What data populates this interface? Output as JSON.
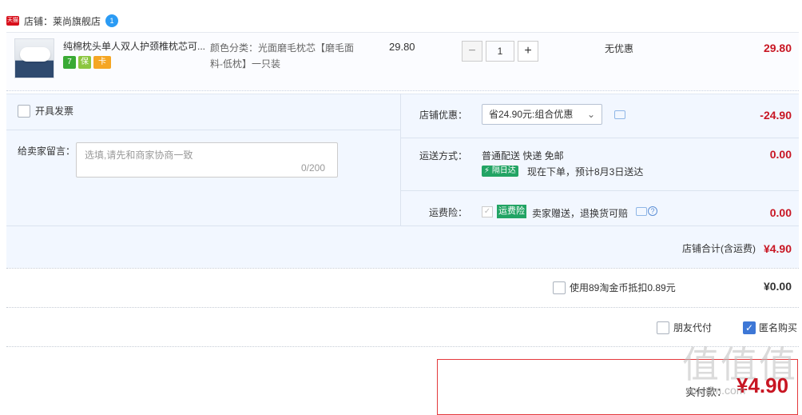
{
  "shop": {
    "badge": "天猫",
    "label": "店铺：",
    "name": "莱尚旗舰店",
    "wangwang_label": "1"
  },
  "item": {
    "title": "纯棉枕头单人双人护颈椎枕芯可...",
    "sku": "颜色分类：光面磨毛枕芯【磨毛面料-低枕】一只装",
    "unit_price": "29.80",
    "quantity": "1",
    "minus": "−",
    "plus": "+",
    "discount": "无优惠",
    "total": "29.80",
    "badges": [
      {
        "icon": "seven-day-return-icon",
        "text": "7",
        "color": "#3aaa35"
      },
      {
        "icon": "guarantee-icon",
        "text": "保",
        "color": "#8cc63f"
      },
      {
        "icon": "credit-card-icon",
        "text": "卡",
        "color": "#f5a623"
      }
    ]
  },
  "invoice": {
    "label": "开具发票"
  },
  "message": {
    "label": "给卖家留言：",
    "placeholder": "选填,请先和商家协商一致",
    "count": "0/200"
  },
  "promo": {
    "label": "店铺优惠：",
    "selected": "省24.90元:组合优惠",
    "amount": "-24.90"
  },
  "shipping": {
    "label": "运送方式：",
    "method": "普通配送 快递 免邮",
    "next_day": "隔日达",
    "eta": "现在下单，预计8月3日送达",
    "amount": "0.00"
  },
  "insurance": {
    "label": "运费险：",
    "badge": "运费险",
    "text": "卖家赠送，退换货可赔",
    "amount": "0.00"
  },
  "shop_total": {
    "label": "店铺合计(含运费)",
    "amount": "¥4.90"
  },
  "coins": {
    "label": "使用89淘金币抵扣0.89元",
    "amount": "¥0.00"
  },
  "options": {
    "friend_pay": "朋友代付",
    "anonymous": "匿名购买",
    "anonymous_checked": true
  },
  "payment": {
    "label": "实付款：",
    "amount": "¥4.90"
  },
  "watermark": {
    "text": "值值值",
    "url": "smzdm.com"
  },
  "colors": {
    "price_red": "#c81623",
    "panel_bg": "#f2f7ff",
    "green": "#22a464",
    "checkbox_blue": "#3d77d6"
  }
}
